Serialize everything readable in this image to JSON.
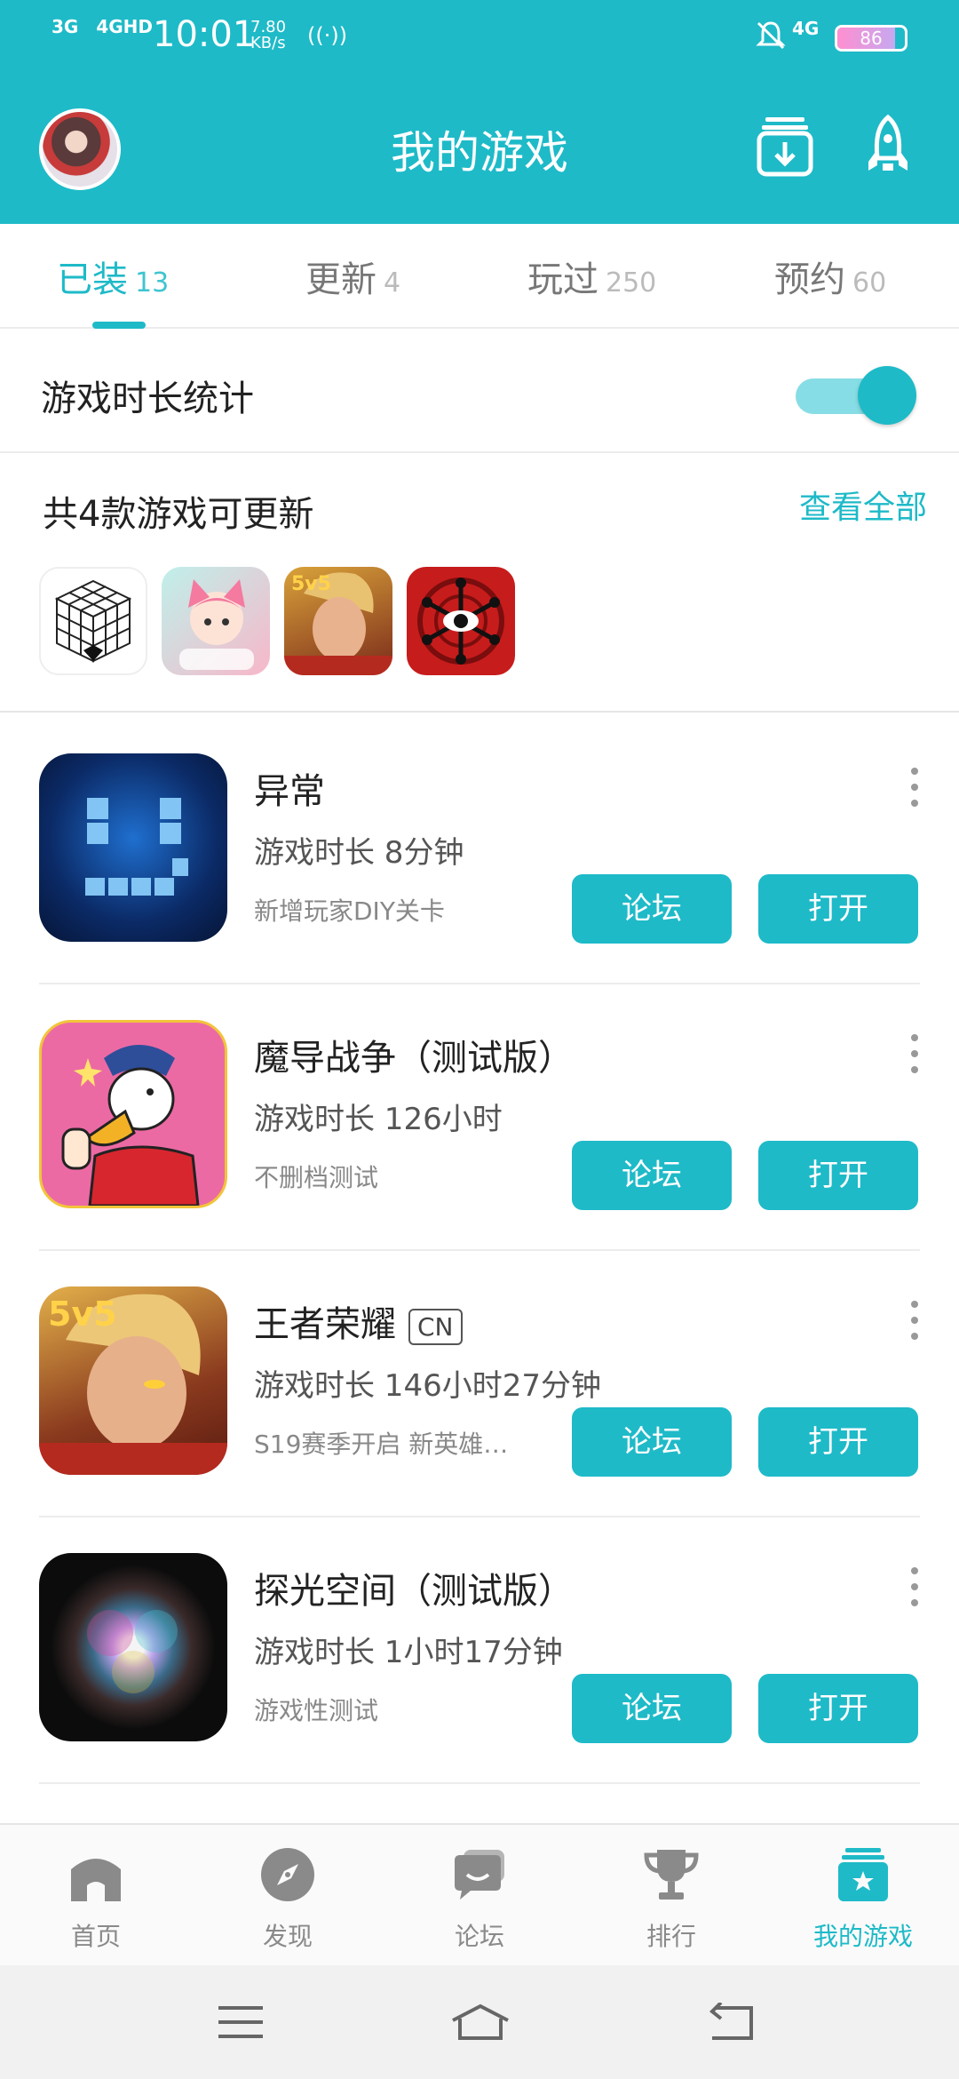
{
  "status_bar": {
    "signal_1": "3G",
    "signal_2": "4GHD",
    "time": "10:01",
    "speed_value": "7.80",
    "speed_unit": "KB/s",
    "network": "4G",
    "battery": "86"
  },
  "header": {
    "title": "我的游戏"
  },
  "tabs": [
    {
      "label": "已装",
      "count": "13"
    },
    {
      "label": "更新",
      "count": "4"
    },
    {
      "label": "玩过",
      "count": "250"
    },
    {
      "label": "预约",
      "count": "60"
    }
  ],
  "playtime_stats": {
    "label": "游戏时长统计",
    "enabled": true
  },
  "updates": {
    "title": "共4款游戏可更新",
    "see_all": "查看全部"
  },
  "games": [
    {
      "name": "异常",
      "tag": "",
      "playtime": "游戏时长 8分钟",
      "desc": "新增玩家DIY关卡",
      "forum": "论坛",
      "open": "打开"
    },
    {
      "name": "魔导战争（测试版）",
      "tag": "",
      "playtime": "游戏时长 126小时",
      "desc": "不删档测试",
      "forum": "论坛",
      "open": "打开"
    },
    {
      "name": "王者荣耀",
      "tag": "CN",
      "playtime": "游戏时长 146小时27分钟",
      "desc": "S19赛季开启 新英雄…",
      "forum": "论坛",
      "open": "打开"
    },
    {
      "name": "探光空间（测试版）",
      "tag": "",
      "playtime": "游戏时长 1小时17分钟",
      "desc": "游戏性测试",
      "forum": "论坛",
      "open": "打开"
    }
  ],
  "bottom_nav": [
    {
      "label": "首页",
      "icon": "home-icon"
    },
    {
      "label": "发现",
      "icon": "compass-icon"
    },
    {
      "label": "论坛",
      "icon": "chat-icon"
    },
    {
      "label": "排行",
      "icon": "trophy-icon"
    },
    {
      "label": "我的游戏",
      "icon": "my-games-icon"
    }
  ],
  "colors": {
    "accent": "#1ebac8",
    "toggle_track": "#87dde5"
  }
}
